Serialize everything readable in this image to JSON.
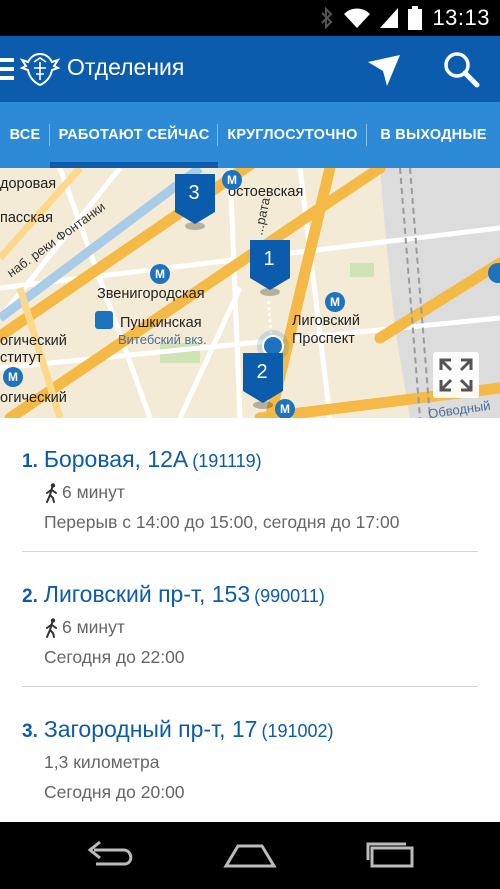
{
  "status_bar": {
    "time": "13:13",
    "icons": [
      "bluetooth-icon",
      "wifi-icon",
      "signal-icon",
      "battery-icon"
    ]
  },
  "app_bar": {
    "title": "Отделения",
    "icons": [
      "menu-icon",
      "post-logo",
      "location-arrow-icon",
      "search-icon"
    ]
  },
  "tabs": [
    {
      "label": "ВСЕ",
      "active": false
    },
    {
      "label": "РАБОТАЮТ СЕЙЧАС",
      "active": true
    },
    {
      "label": "КРУГЛОСУТОЧНО",
      "active": false
    },
    {
      "label": "В ВЫХОДНЫЕ",
      "active": false
    }
  ],
  "map": {
    "labels": {
      "dostoevskaya": "остоевская",
      "zvenigorodskaya": "Звенигородская",
      "pushkinskaya": "Пушкинская",
      "vitebsky": "Витебский вкз.",
      "ligovsky1": "Лиговский",
      "ligovsky2": "Проспект",
      "fontanka": "наб. реки Фонтанки",
      "sadovaya": "доровая",
      "pasport": "пасская",
      "logich1": "огический",
      "logich2": "ститут",
      "logich3": "огический",
      "ulitsa": "ул. ...рата",
      "obvodny": "Обводный"
    },
    "pins": [
      {
        "number": "3"
      },
      {
        "number": "1"
      },
      {
        "number": "2"
      }
    ],
    "metro_symbol": "М"
  },
  "offices": [
    {
      "number": "1.",
      "address": "Боровая, 12А",
      "zip": "(191119)",
      "distance": "6 минут",
      "walking": true,
      "hours": "Перерыв с 14:00 до 15:00, сегодня до 17:00"
    },
    {
      "number": "2.",
      "address": "Лиговский пр-т, 153",
      "zip": "(990011)",
      "distance": "6 минут",
      "walking": true,
      "hours": "Сегодня до 22:00"
    },
    {
      "number": "3.",
      "address": "Загородный пр-т, 17",
      "zip": "(191002)",
      "distance": "1,3 километра",
      "walking": false,
      "hours": "Сегодня до 20:00"
    }
  ],
  "colors": {
    "app_bar": "#0b5cad",
    "tabs": "#2d8ad6",
    "link": "#0b5cad",
    "secondary_text": "#666666"
  }
}
